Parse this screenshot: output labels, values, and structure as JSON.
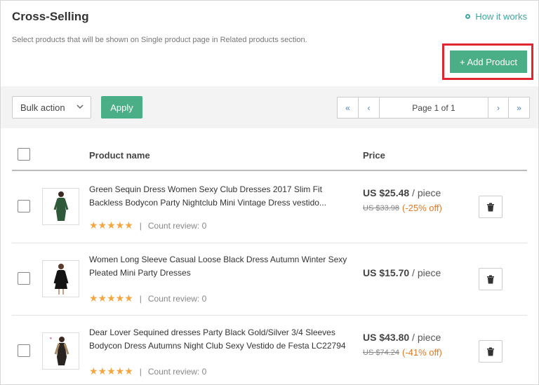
{
  "header": {
    "title": "Cross-Selling",
    "how_it_works": "How it works",
    "description": "Select products that will be shown on Single product page in Related products section.",
    "add_product": "+ Add Product"
  },
  "toolbar": {
    "bulk_action": "Bulk action",
    "apply": "Apply",
    "page_info": "Page 1 of 1",
    "first": "«",
    "prev": "‹",
    "next": "›",
    "last": "»"
  },
  "table": {
    "col_product": "Product name",
    "col_price": "Price",
    "rows": [
      {
        "name_line1": "Green Sequin Dress Women Sexy Club Dresses 2017 Slim Fit",
        "name_line2": "Backless Bodycon Party Nightclub Mini Vintage Dress vestido...",
        "stars": "★★★★★",
        "sep": "|",
        "review": "Count review: 0",
        "price": "US $25.48",
        "unit": " / piece",
        "old_price": "US $33.98",
        "discount": "(-25% off)"
      },
      {
        "name_line1": "Women Long Sleeve Casual Loose Black Dress Autumn Winter Sexy",
        "name_line2": "Pleated Mini Party Dresses",
        "stars": "★★★★★",
        "sep": "|",
        "review": "Count review: 0",
        "price": "US $15.70",
        "unit": " / piece"
      },
      {
        "name_line1": "Dear Lover Sequined dresses Party Black Gold/Silver 3/4 Sleeves",
        "name_line2": "Bodycon Dress Autumns Night Club Sexy Vestido de Festa LC22794",
        "stars": "★★★★★",
        "sep": "|",
        "review": "Count review: 0",
        "price": "US $43.80",
        "unit": " / piece",
        "old_price": "US $74.24",
        "discount": "(-41% off)"
      }
    ]
  },
  "colors": {
    "accent": "#4aae86",
    "link": "#3aa99f",
    "highlight": "#e0262f",
    "star": "#f3a640",
    "discount": "#e07a28"
  },
  "icons": {
    "how_it_works": "info-dot-icon",
    "bulk_chevron": "chevron-down-icon",
    "delete": "trash-icon"
  }
}
